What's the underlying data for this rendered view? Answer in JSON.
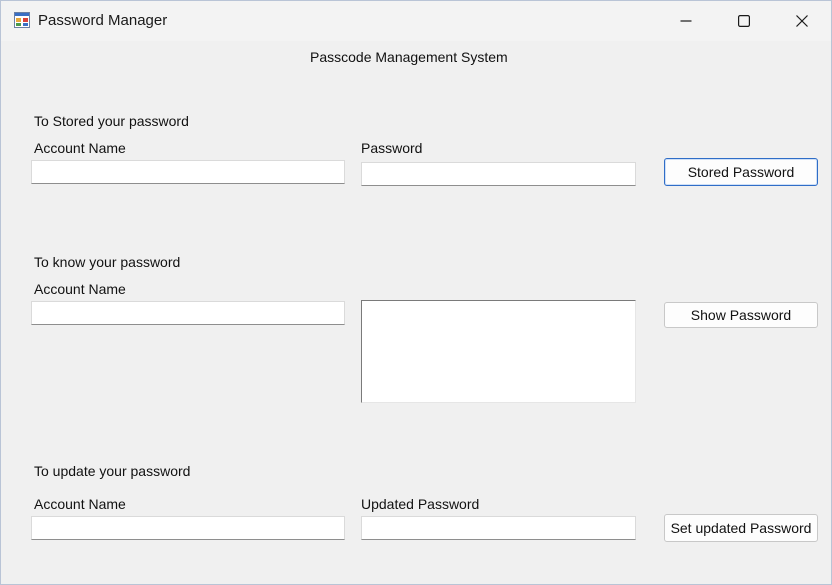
{
  "window": {
    "title": "Password Manager",
    "header": "Passcode Management System"
  },
  "icons": {
    "app": "password-manager-app-icon",
    "minimize": "minimize-icon",
    "maximize": "maximize-icon",
    "close": "close-icon"
  },
  "colors": {
    "window_bg": "#f0f0f0",
    "focus_border": "#2f6dc7"
  },
  "store_section": {
    "heading": "To Stored your password",
    "account_label": "Account Name",
    "account_value": "",
    "password_label": "Password",
    "password_value": "",
    "button": "Stored Password"
  },
  "show_section": {
    "heading": "To know your password",
    "account_label": "Account Name",
    "account_value": "",
    "output_value": "",
    "button": "Show Password"
  },
  "update_section": {
    "heading": "To update your password",
    "account_label": "Account Name",
    "account_value": "",
    "updated_label": "Updated Password",
    "updated_value": "",
    "button": "Set updated Password"
  }
}
